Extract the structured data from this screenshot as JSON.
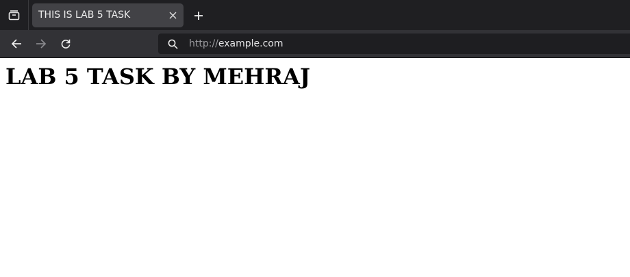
{
  "browser": {
    "tab": {
      "title": "THIS IS LAB 5 TASK"
    },
    "url": {
      "scheme": "http://",
      "host": "example.com"
    },
    "icons": {
      "tab_overview": "tab-overview-icon",
      "tab_close": "close-icon",
      "new_tab": "plus-icon",
      "back": "arrow-left-icon",
      "forward": "arrow-right-icon",
      "reload": "reload-icon",
      "search": "search-icon"
    },
    "colors": {
      "tabstrip": "#1f1f22",
      "active_tab": "#424246",
      "toolbar": "#323236",
      "urlbar": "#1e1e21"
    }
  },
  "page": {
    "heading": "LAB 5 TASK BY MEHRAJ"
  }
}
